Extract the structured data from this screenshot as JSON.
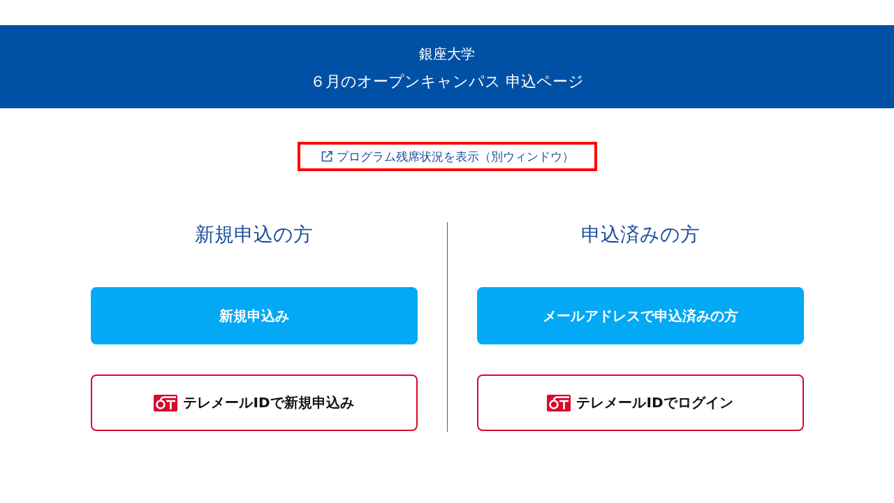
{
  "header": {
    "university": "銀座大学",
    "title": "６月のオープンキャンパス 申込ページ"
  },
  "availability_link": {
    "label": "プログラム残席状況を表示（別ウィンドウ）",
    "highlighted": true
  },
  "columns": [
    {
      "heading": "新規申込の方",
      "buttons": [
        {
          "kind": "primary",
          "label": "新規申込み"
        },
        {
          "kind": "telemail",
          "label": "テレメールIDで新規申込み"
        }
      ]
    },
    {
      "heading": "申込済みの方",
      "buttons": [
        {
          "kind": "primary",
          "label": "メールアドレスで申込済みの方"
        },
        {
          "kind": "telemail",
          "label": "テレメールIDでログイン"
        }
      ]
    }
  ]
}
